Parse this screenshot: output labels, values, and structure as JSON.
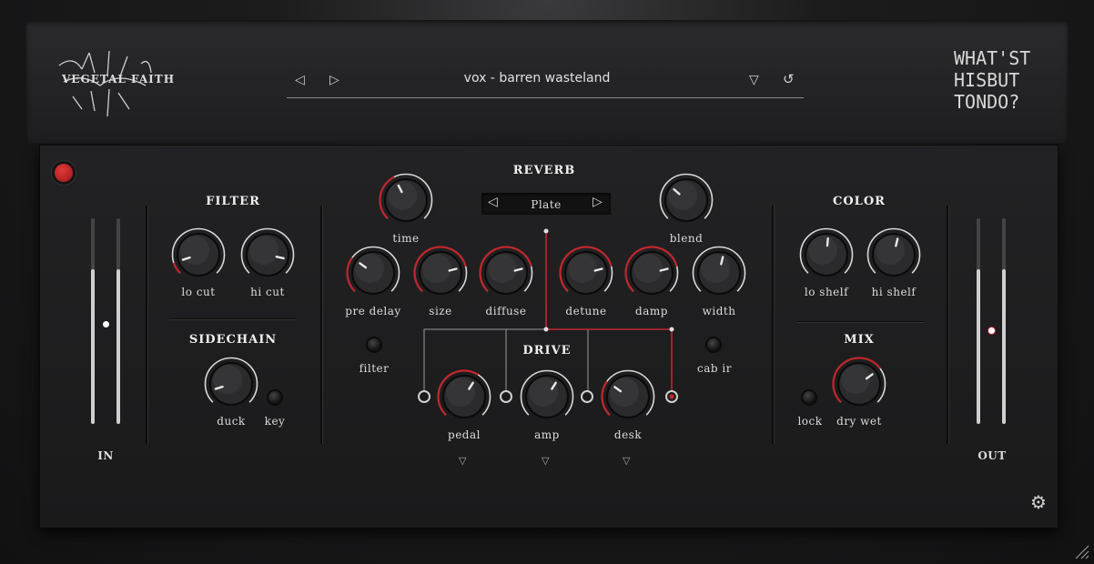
{
  "header": {
    "logo_left": "VEGETAL FAITH",
    "preset_name": "vox - barren wasteland",
    "logo_right": [
      "WHAT'ST",
      "HISBUT",
      "TONDO?"
    ]
  },
  "filter": {
    "title": "FILTER",
    "lo_cut": "lo cut",
    "hi_cut": "hi cut"
  },
  "sidechain": {
    "title": "SIDECHAIN",
    "duck": "duck",
    "key": "key"
  },
  "meters": {
    "in_label": "IN",
    "out_label": "OUT"
  },
  "reverb": {
    "title": "REVERB",
    "type": "Plate",
    "time": "time",
    "blend": "blend",
    "pre_delay": "pre delay",
    "size": "size",
    "diffuse": "diffuse",
    "detune": "detune",
    "damp": "damp",
    "width": "width"
  },
  "switches": {
    "filter": "filter",
    "cab_ir": "cab ir"
  },
  "drive": {
    "title": "DRIVE",
    "pedal": "pedal",
    "amp": "amp",
    "desk": "desk"
  },
  "color": {
    "title": "COLOR",
    "lo_shelf": "lo shelf",
    "hi_shelf": "hi shelf"
  },
  "mix": {
    "title": "MIX",
    "lock": "lock",
    "dry_wet": "dry wet"
  },
  "colors": {
    "accent": "#c0272d",
    "arc": "#d9d9d9",
    "knob": "#2b2b2d"
  }
}
